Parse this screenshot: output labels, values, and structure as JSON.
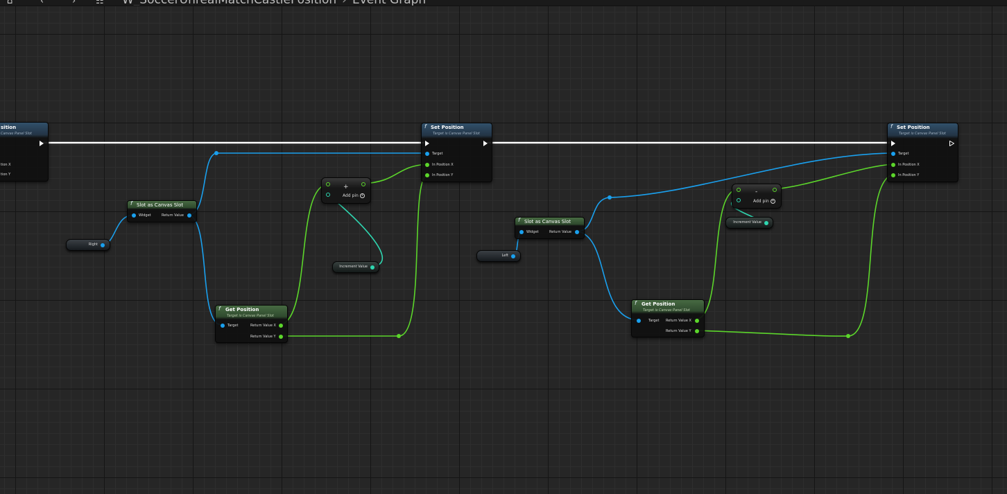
{
  "toolbar": {
    "home_icon": "home-icon",
    "back_icon": "back-arrow-icon",
    "forward_icon": "forward-arrow-icon",
    "blueprint_icon": "blueprint-tree-icon",
    "asset_path": "W_SoccerUnrealMatchCastlePosition",
    "graph_name": "Event Graph"
  },
  "colors": {
    "exec_wire": "#ffffff",
    "object_wire": "#1aa0ee",
    "vector_wire": "#5cd62b",
    "float_wire": "#2fd6b0",
    "graph_bg": "#262626"
  },
  "nodes": {
    "set_position_partial": {
      "title": "sition",
      "subtitle": "Canvas Panel Slot",
      "pins": [
        "tion X",
        "tion Y"
      ]
    },
    "set_position_1": {
      "title": "Set Position",
      "subtitle": "Target is Canvas Panel Slot",
      "pins": [
        "Target",
        "In Position X",
        "In Position Y"
      ]
    },
    "set_position_2": {
      "title": "Set Position",
      "subtitle": "Target is Canvas Panel Slot",
      "pins": [
        "Target",
        "In Position X",
        "In Position Y"
      ]
    },
    "slot_as_canvas_slot_1": {
      "title": "Slot as Canvas Slot",
      "pin_in": "Widget",
      "pin_out": "Return Value"
    },
    "slot_as_canvas_slot_2": {
      "title": "Slot as Canvas Slot",
      "pin_in": "Widget",
      "pin_out": "Return Value"
    },
    "get_position_1": {
      "title": "Get Position",
      "subtitle": "Target is Canvas Panel Slot",
      "pin_in": "Target",
      "pins_out": [
        "Return Value X",
        "Return Value Y"
      ]
    },
    "get_position_2": {
      "title": "Get Position",
      "subtitle": "Target is Canvas Panel Slot",
      "pin_in": "Target",
      "pins_out": [
        "Return Value X",
        "Return Value Y"
      ]
    },
    "add_node": {
      "symbol": "+",
      "add_pin_label": "Add pin"
    },
    "subtract_node": {
      "symbol": "-",
      "add_pin_label": "Add pin"
    }
  },
  "variables": {
    "right": "Right",
    "left": "Left",
    "increment_1": "Increment Value",
    "increment_2": "Increment Value"
  }
}
